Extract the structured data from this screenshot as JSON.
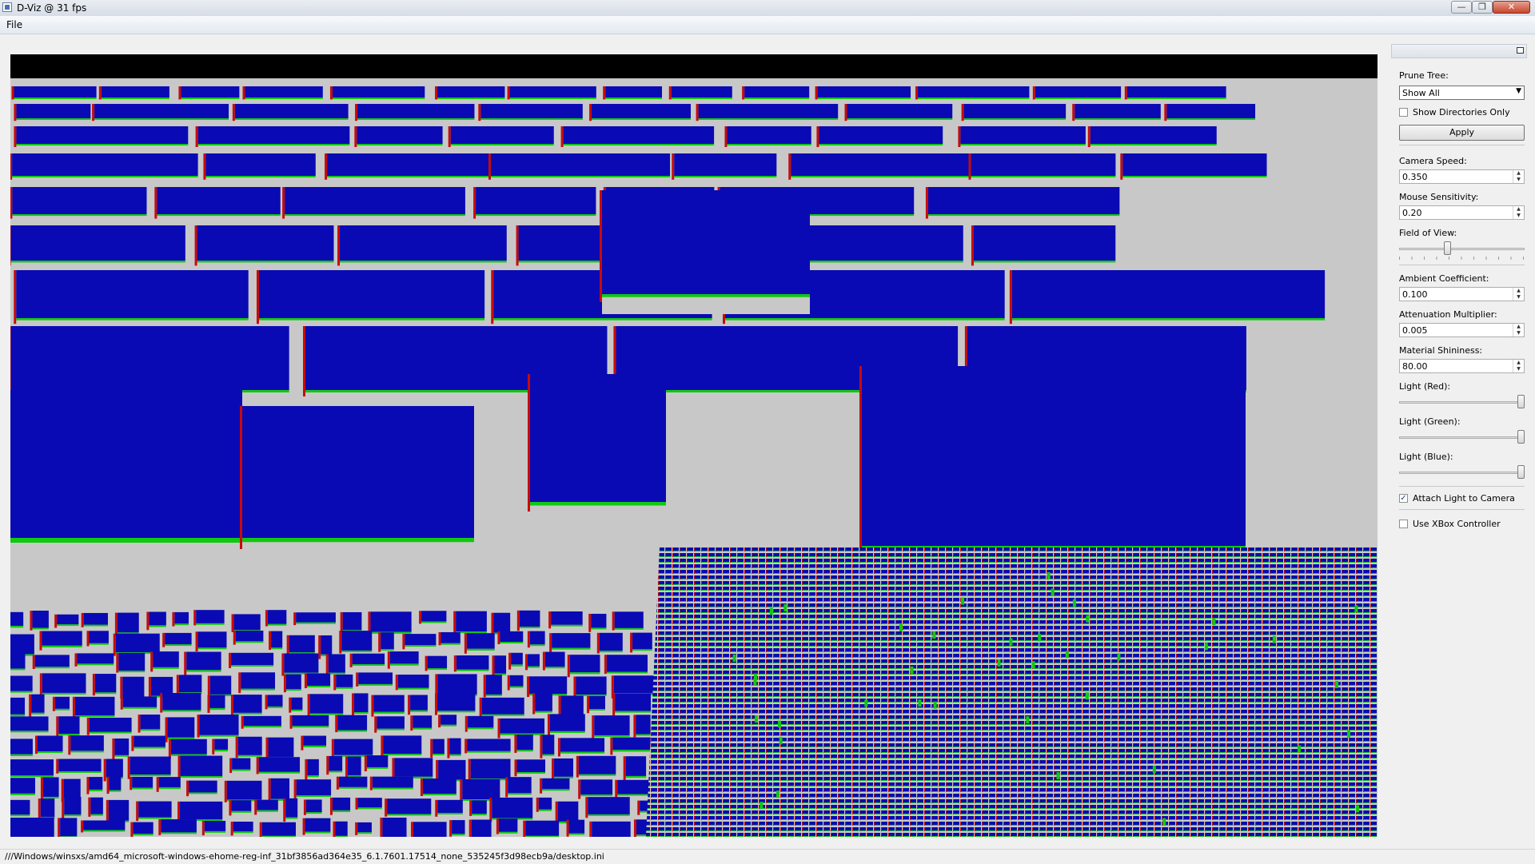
{
  "window": {
    "title": "D-Viz @ 31 fps",
    "min_glyph": "—",
    "max_glyph": "❐",
    "close_glyph": "✕"
  },
  "menu": {
    "file": "File"
  },
  "panel": {
    "prune_tree_label": "Prune Tree:",
    "prune_tree_value": "Show All",
    "show_dirs_only": "Show Directories Only",
    "show_dirs_only_checked": false,
    "apply": "Apply",
    "camera_speed_label": "Camera Speed:",
    "camera_speed": "0.350",
    "mouse_sensitivity_label": "Mouse Sensitivity:",
    "mouse_sensitivity": "0.20",
    "fov_label": "Field of View:",
    "ambient_label": "Ambient Coefficient:",
    "ambient": "0.100",
    "attenuation_label": "Attenuation Multiplier:",
    "attenuation": "0.005",
    "shininess_label": "Material Shininess:",
    "shininess": "80.00",
    "light_red_label": "Light (Red):",
    "light_green_label": "Light (Green):",
    "light_blue_label": "Light (Blue):",
    "attach_light": "Attach Light to Camera",
    "attach_light_checked": true,
    "use_xbox": "Use XBox Controller",
    "use_xbox_checked": false,
    "check_glyph": "✓",
    "dropdown_glyph": "▼",
    "spin_up": "▲",
    "spin_down": "▼"
  },
  "sliders": {
    "field_of_view": 0.38,
    "light_red": 1.0,
    "light_green": 1.0,
    "light_blue": 1.0
  },
  "status": {
    "path": "///Windows/winsxs/amd64_microsoft-windows-ehome-reg-inf_31bf3856ad364e35_6.1.7601.17514_none_535245f3d98ecb9a/desktop.ini"
  },
  "colors": {
    "block_top": "#0a0ab4",
    "block_edge_green": "#12c812",
    "block_edge_red": "#c80a0a",
    "block_side": "#c8c8c8",
    "sky": "#000000"
  },
  "icons": [
    "app-icon",
    "minimize-icon",
    "maximize-icon",
    "close-icon",
    "panel-float-icon",
    "dropdown-arrow-icon",
    "spin-arrow-icon",
    "check-icon"
  ]
}
